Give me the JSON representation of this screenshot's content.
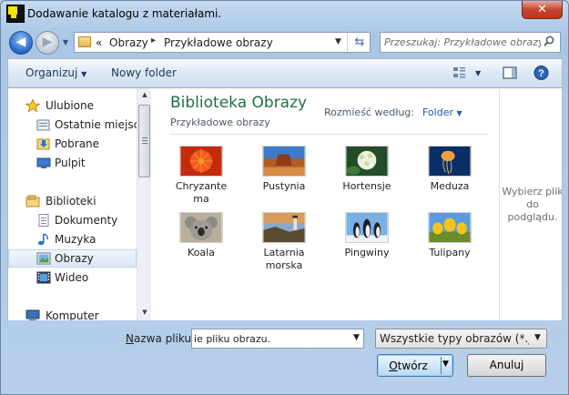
{
  "window": {
    "title": "Dodawanie katalogu z materiałami.",
    "close_glyph": "✕"
  },
  "nav": {
    "back_glyph": "◀",
    "forward_glyph": "▶",
    "breadcrumb_prefix": "«",
    "breadcrumb": [
      "Obrazy",
      "Przykładowe obrazy"
    ],
    "breadcrumb_separator": "▸",
    "search_placeholder": "Przeszukaj: Przykładowe obrazy"
  },
  "toolbar": {
    "organize_label": "Organizuj",
    "new_folder_label": "Nowy folder"
  },
  "sidebar": {
    "items": [
      {
        "label": "Ulubione",
        "icon": "star-icon"
      },
      {
        "label": "Ostatnie miejsca",
        "icon": "recent-places-icon"
      },
      {
        "label": "Pobrane",
        "icon": "downloads-icon"
      },
      {
        "label": "Pulpit",
        "icon": "desktop-icon"
      },
      {
        "label": "Biblioteki",
        "icon": "libraries-icon"
      },
      {
        "label": "Dokumenty",
        "icon": "documents-icon"
      },
      {
        "label": "Muzyka",
        "icon": "music-icon"
      },
      {
        "label": "Obrazy",
        "icon": "pictures-icon",
        "selected": true
      },
      {
        "label": "Wideo",
        "icon": "video-icon"
      },
      {
        "label": "Komputer",
        "icon": "computer-icon"
      }
    ]
  },
  "library": {
    "title": "Biblioteka Obrazy",
    "subtitle": "Przykładowe obrazy",
    "arrange_label": "Rozmieść według:",
    "arrange_value": "Folder"
  },
  "files": [
    {
      "name": "Chryzante ma",
      "name_line1": "Chryzante",
      "name_line2": "ma",
      "icon": "chrysanthemum-thumbnail"
    },
    {
      "name": "Pustynia",
      "name_line1": "Pustynia",
      "name_line2": "",
      "icon": "desert-thumbnail"
    },
    {
      "name": "Hortensje",
      "name_line1": "Hortensje",
      "name_line2": "",
      "icon": "hydrangeas-thumbnail"
    },
    {
      "name": "Meduza",
      "name_line1": "Meduza",
      "name_line2": "",
      "icon": "jellyfish-thumbnail"
    },
    {
      "name": "Koala",
      "name_line1": "Koala",
      "name_line2": "",
      "icon": "koala-thumbnail"
    },
    {
      "name": "Latarnia morska",
      "name_line1": "Latarnia",
      "name_line2": "morska",
      "icon": "lighthouse-thumbnail"
    },
    {
      "name": "Pingwiny",
      "name_line1": "Pingwiny",
      "name_line2": "",
      "icon": "penguins-thumbnail"
    },
    {
      "name": "Tulipany",
      "name_line1": "Tulipany",
      "name_line2": "",
      "icon": "tulips-thumbnail"
    }
  ],
  "preview": {
    "line1": "Wybierz plik",
    "line2": "do",
    "line3": "podglądu."
  },
  "bottom": {
    "filename_label_first": "N",
    "filename_label_rest": "azwa pliku:",
    "filename_value": "ie pliku obrazu.",
    "filetype_value": "Wszystkie typy obrazów (*.jpg,*",
    "open_first": "O",
    "open_rest": "twórz",
    "cancel_label": "Anuluj"
  },
  "colors": {
    "library_title": "#1e7040",
    "link_blue": "#1d5bb5",
    "close_red": "#c8452f"
  }
}
